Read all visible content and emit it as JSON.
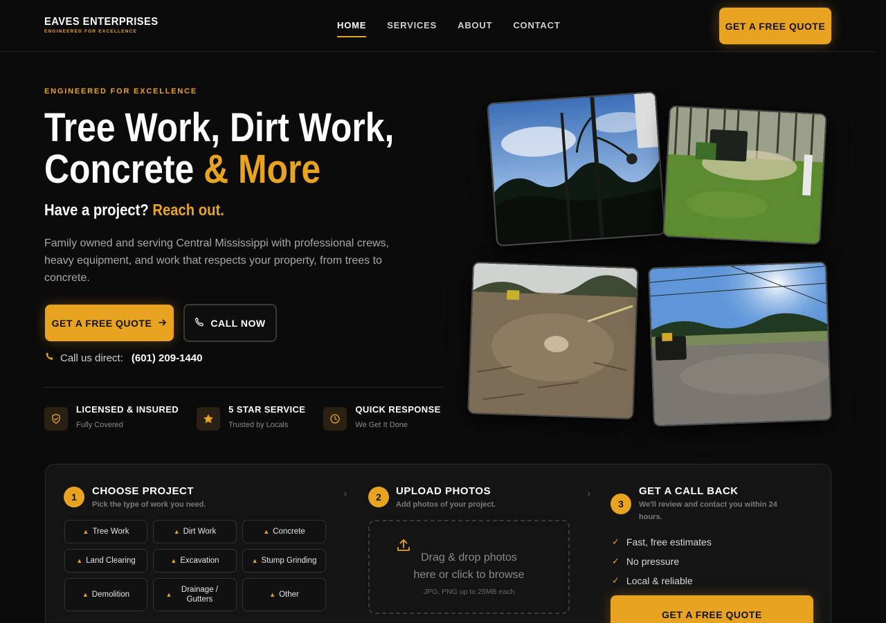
{
  "brand": {
    "name": "EAVES ENTERPRISES",
    "tagline": "ENGINEERED FOR EXCELLENCE"
  },
  "nav": {
    "items": [
      "HOME",
      "SERVICES",
      "ABOUT",
      "CONTACT"
    ],
    "active": "HOME"
  },
  "header": {
    "cta_label": "GET A FREE QUOTE"
  },
  "hero": {
    "eyebrow": "ENGINEERED FOR EXCELLENCE",
    "headline_line1": "Tree Work, Dirt Work,",
    "headline_line2_main": "Concrete ",
    "headline_line2_accent": "& More",
    "subhead_main": "Have a project? ",
    "subhead_accent": "Reach out.",
    "description": "Family owned and serving Central Mississippi with professional crews, heavy equipment, and work that respects your property, from trees to concrete.",
    "primary_cta": "GET A FREE QUOTE",
    "secondary_cta": "CALL NOW",
    "call_label": "Call us direct:",
    "phone": "(601) 209-1440"
  },
  "badges": [
    {
      "title": "LICENSED & INSURED",
      "sub": "Fully Covered",
      "icon": "shield-icon"
    },
    {
      "title": "5 STAR SERVICE",
      "sub": "Trusted by Locals",
      "icon": "star-icon"
    },
    {
      "title": "QUICK RESPONSE",
      "sub": "We Get It Done",
      "icon": "clock-icon"
    }
  ],
  "steps": [
    {
      "num": "1",
      "title": "CHOOSE PROJECT",
      "sub": "Pick the type of work you need."
    },
    {
      "num": "2",
      "title": "UPLOAD PHOTOS",
      "sub": "Add photos of your project."
    },
    {
      "num": "3",
      "title": "GET A CALL BACK",
      "sub": "We'll review and contact you within 24 hours."
    }
  ],
  "projects": [
    "Tree Work",
    "Dirt Work",
    "Concrete",
    "Land Clearing",
    "Excavation",
    "Stump Grinding",
    "Demolition",
    "Drainage / Gutters",
    "Other"
  ],
  "upload": {
    "main": "Drag & drop photos here or click to browse",
    "hint": "JPG, PNG up to 25MB each"
  },
  "benefits": [
    "Fast, free estimates",
    "No pressure",
    "Local & reliable"
  ],
  "panel_cta": "GET A FREE QUOTE",
  "colors": {
    "accent": "#e8a321",
    "background": "#0b0b0b",
    "panel": "#141414"
  }
}
